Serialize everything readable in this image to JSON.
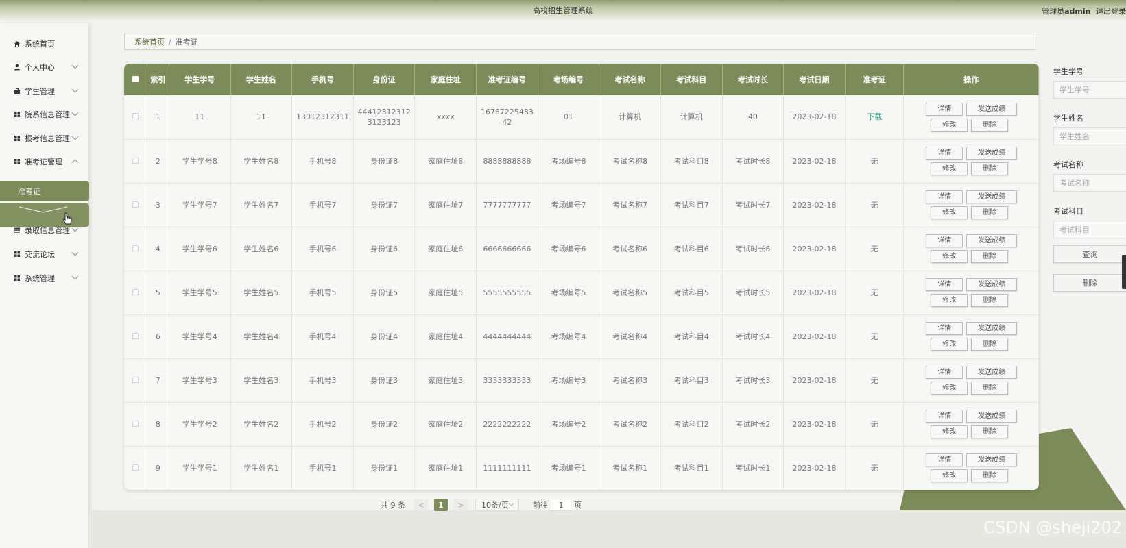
{
  "header": {
    "title": "高校招生管理系统",
    "user_label": "管理员",
    "user_name": "admin",
    "logout": "退出登录"
  },
  "sidebar": {
    "items": [
      {
        "label": "系统首页",
        "icon": "home-icon"
      },
      {
        "label": "个人中心",
        "icon": "user-icon"
      },
      {
        "label": "学生管理",
        "icon": "briefcase-icon"
      },
      {
        "label": "院系信息管理",
        "icon": "grid-icon"
      },
      {
        "label": "报考信息管理",
        "icon": "grid-icon"
      },
      {
        "label": "准考证管理",
        "icon": "grid-icon"
      },
      {
        "label": "录取信息管理",
        "icon": "list-icon"
      },
      {
        "label": "交流论坛",
        "icon": "grid-icon"
      },
      {
        "label": "系统管理",
        "icon": "grid-icon"
      }
    ],
    "active_sub": "准考证"
  },
  "breadcrumb": {
    "home": "系统首页",
    "sep": "/",
    "current": "准考证"
  },
  "table": {
    "columns": [
      "索引",
      "学生学号",
      "学生姓名",
      "手机号",
      "身份证",
      "家庭住址",
      "准考证编号",
      "考场编号",
      "考试名称",
      "考试科目",
      "考试时长",
      "考试日期",
      "准考证",
      "操作"
    ],
    "rows": [
      {
        "idx": "1",
        "sno": "11",
        "sname": "11",
        "phone": "13012312311",
        "idcard": "444123123123123123",
        "addr": "xxxx",
        "ticket": "1676722543342",
        "room": "01",
        "exam": "计算机",
        "subject": "计算机",
        "duration": "40",
        "date": "2023-02-18",
        "file": "下载"
      },
      {
        "idx": "2",
        "sno": "学生学号8",
        "sname": "学生姓名8",
        "phone": "手机号8",
        "idcard": "身份证8",
        "addr": "家庭住址8",
        "ticket": "8888888888",
        "room": "考场编号8",
        "exam": "考试名称8",
        "subject": "考试科目8",
        "duration": "考试时长8",
        "date": "2023-02-18",
        "file": "无"
      },
      {
        "idx": "3",
        "sno": "学生学号7",
        "sname": "学生姓名7",
        "phone": "手机号7",
        "idcard": "身份证7",
        "addr": "家庭住址7",
        "ticket": "7777777777",
        "room": "考场编号7",
        "exam": "考试名称7",
        "subject": "考试科目7",
        "duration": "考试时长7",
        "date": "2023-02-18",
        "file": "无"
      },
      {
        "idx": "4",
        "sno": "学生学号6",
        "sname": "学生姓名6",
        "phone": "手机号6",
        "idcard": "身份证6",
        "addr": "家庭住址6",
        "ticket": "6666666666",
        "room": "考场编号6",
        "exam": "考试名称6",
        "subject": "考试科目6",
        "duration": "考试时长6",
        "date": "2023-02-18",
        "file": "无"
      },
      {
        "idx": "5",
        "sno": "学生学号5",
        "sname": "学生姓名5",
        "phone": "手机号5",
        "idcard": "身份证5",
        "addr": "家庭住址5",
        "ticket": "5555555555",
        "room": "考场编号5",
        "exam": "考试名称5",
        "subject": "考试科目5",
        "duration": "考试时长5",
        "date": "2023-02-18",
        "file": "无"
      },
      {
        "idx": "6",
        "sno": "学生学号4",
        "sname": "学生姓名4",
        "phone": "手机号4",
        "idcard": "身份证4",
        "addr": "家庭住址4",
        "ticket": "4444444444",
        "room": "考场编号4",
        "exam": "考试名称4",
        "subject": "考试科目4",
        "duration": "考试时长4",
        "date": "2023-02-18",
        "file": "无"
      },
      {
        "idx": "7",
        "sno": "学生学号3",
        "sname": "学生姓名3",
        "phone": "手机号3",
        "idcard": "身份证3",
        "addr": "家庭住址3",
        "ticket": "3333333333",
        "room": "考场编号3",
        "exam": "考试名称3",
        "subject": "考试科目3",
        "duration": "考试时长3",
        "date": "2023-02-18",
        "file": "无"
      },
      {
        "idx": "8",
        "sno": "学生学号2",
        "sname": "学生姓名2",
        "phone": "手机号2",
        "idcard": "身份证2",
        "addr": "家庭住址2",
        "ticket": "2222222222",
        "room": "考场编号2",
        "exam": "考试名称2",
        "subject": "考试科目2",
        "duration": "考试时长2",
        "date": "2023-02-18",
        "file": "无"
      },
      {
        "idx": "9",
        "sno": "学生学号1",
        "sname": "学生姓名1",
        "phone": "手机号1",
        "idcard": "身份证1",
        "addr": "家庭住址1",
        "ticket": "1111111111",
        "room": "考场编号1",
        "exam": "考试名称1",
        "subject": "考试科目1",
        "duration": "考试时长1",
        "date": "2023-02-18",
        "file": "无"
      }
    ],
    "actions": {
      "detail": "详情",
      "send": "发送成绩",
      "edit": "修改",
      "delete": "删除"
    }
  },
  "pager": {
    "total": "共 9 条",
    "prev": "<",
    "page": "1",
    "next": ">",
    "size": "10条/页",
    "goto": "前往",
    "goto_value": "1",
    "unit": "页"
  },
  "search": {
    "fields": [
      {
        "label": "学生学号",
        "placeholder": "学生学号"
      },
      {
        "label": "学生姓名",
        "placeholder": "学生姓名"
      },
      {
        "label": "考试名称",
        "placeholder": "考试名称"
      },
      {
        "label": "考试科目",
        "placeholder": "考试科目"
      }
    ],
    "query_btn": "查询",
    "delete_btn": "删除"
  },
  "watermark": "CSDN @sheji202",
  "colors": {
    "accent": "#7d8b5a",
    "link": "#2a9a80"
  }
}
